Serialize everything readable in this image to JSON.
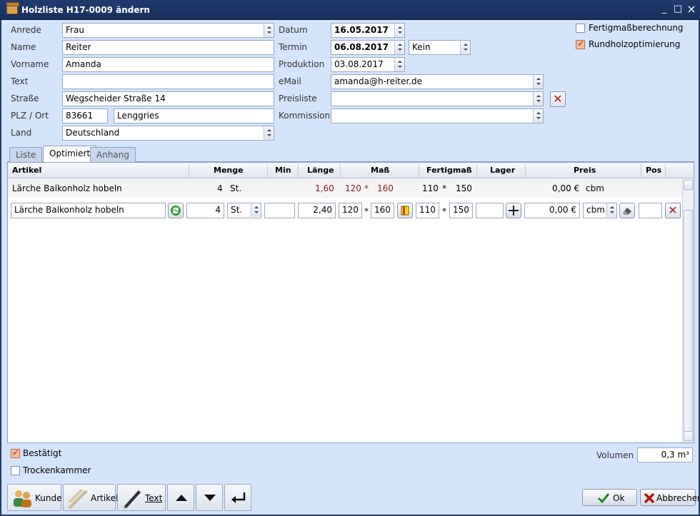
{
  "window": {
    "title": "Holzliste H17-0009 ändern"
  },
  "window_controls": {
    "minimize": "_",
    "maximize": "□",
    "close": "×"
  },
  "customer": {
    "anrede_label": "Anrede",
    "anrede_value": "Frau",
    "name_label": "Name",
    "name_value": "Reiter",
    "vorname_label": "Vorname",
    "vorname_value": "Amanda",
    "text_label": "Text",
    "text_value": "",
    "strasse_label": "Straße",
    "strasse_value": "Wegscheider Straße 14",
    "plz_ort_label": "PLZ / Ort",
    "plz_value": "83661",
    "ort_value": "Lenggries",
    "land_label": "Land",
    "land_value": "Deutschland"
  },
  "order": {
    "datum_label": "Datum",
    "datum_value": "16.05.2017",
    "termin_label": "Termin",
    "termin_value": "06.08.2017",
    "termin_option": "Kein",
    "produktion_label": "Produktion",
    "produktion_value": "03.08.2017",
    "email_label": "eMail",
    "email_value": "amanda@h-reiter.de",
    "preisliste_label": "Preisliste",
    "preisliste_value": "",
    "kommission_label": "Kommission",
    "kommission_value": ""
  },
  "options": [
    {
      "label": "Fertigmaßberechnung",
      "checked": false
    },
    {
      "label": "Rundholzoptimierung",
      "checked": true
    }
  ],
  "tabs": [
    {
      "label": "Liste",
      "active": false
    },
    {
      "label": "Optimiert",
      "active": true
    },
    {
      "label": "Anhang",
      "active": false
    }
  ],
  "grid": {
    "columns": [
      "Artikel",
      "Menge",
      "Min",
      "Länge",
      "Maß",
      "Fertigmaß",
      "Lager",
      "Preis",
      "Pos"
    ],
    "row": {
      "artikel": "Lärche Balkonholz hobeln",
      "menge": "4",
      "einheit": "St.",
      "laenge": "1,60",
      "mass_a": "120",
      "mass_sep": "*",
      "mass_b": "160",
      "fertig_a": "110",
      "fertig_sep": "*",
      "fertig_b": "150",
      "preis": "0,00 €",
      "preis_einheit": "cbm"
    },
    "edit_row": {
      "artikel": "Lärche Balkonholz hobeln",
      "menge": "4",
      "einheit": "St.",
      "min": "",
      "laenge": "2,40",
      "mass_a": "120",
      "mass_sep": "*",
      "mass_b": "160",
      "fertig_a": "110",
      "fertig_sep": "*",
      "fertig_b": "150",
      "lager": "",
      "preis": "0,00 €",
      "preis_einheit": "cbm",
      "pos": ""
    }
  },
  "footer": {
    "bestaetigt": {
      "label": "Bestätigt",
      "checked": true
    },
    "trockenkammer": {
      "label": "Trockenkammer",
      "checked": false
    },
    "volumen_label": "Volumen",
    "volumen_value": "0,3 m³"
  },
  "toolbar": {
    "kunde": "Kunde",
    "artikel": "Artikel",
    "text": "Text"
  },
  "actions": {
    "ok": "Ok",
    "abbrechen": "Abbrechen"
  },
  "colors": {
    "title_bar": "#1f3a6e",
    "panel": "#d4e4fb",
    "check_on": "#f3c0a0",
    "delete_red": "#b01616",
    "value_red": "#8b1a1a"
  }
}
